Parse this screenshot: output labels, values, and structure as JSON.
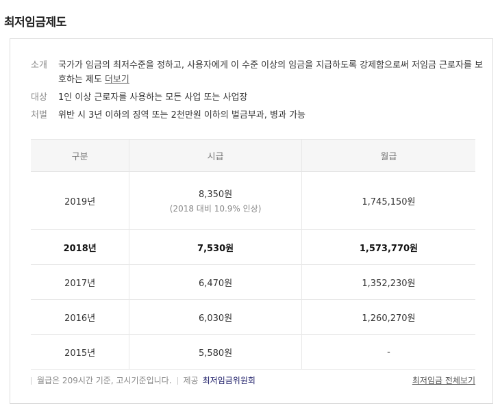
{
  "title": "최저임금제도",
  "info": [
    {
      "label": "소개",
      "text": "국가가 임금의 최저수준을 정하고, 사용자에게 이 수준 이상의 임금을 지급하도록 강제함으로써 저임금 근로자를 보호하는 제도",
      "link": "더보기"
    },
    {
      "label": "대상",
      "text": "1인 이상 근로자를 사용하는 모든 사업 또는 사업장"
    },
    {
      "label": "처벌",
      "text": "위반 시 3년 이하의 징역 또는 2천만원 이하의 벌금부과, 병과 가능"
    }
  ],
  "table": {
    "headers": [
      "구분",
      "시급",
      "월급"
    ],
    "rows": [
      {
        "year": "2019년",
        "hourly": "8,350원",
        "note": "(2018 대비 10.9% 인상)",
        "monthly": "1,745,150원"
      },
      {
        "year": "2018년",
        "hourly": "7,530원",
        "monthly": "1,573,770원"
      },
      {
        "year": "2017년",
        "hourly": "6,470원",
        "monthly": "1,352,230원"
      },
      {
        "year": "2016년",
        "hourly": "6,030원",
        "monthly": "1,260,270원"
      },
      {
        "year": "2015년",
        "hourly": "5,580원",
        "monthly": "-"
      }
    ]
  },
  "footer": {
    "note": "월급은 209시간 기준, 고시기준입니다.",
    "provider_label": "제공",
    "provider": "최저임금위원회",
    "all_link": "최저임금 전체보기"
  }
}
